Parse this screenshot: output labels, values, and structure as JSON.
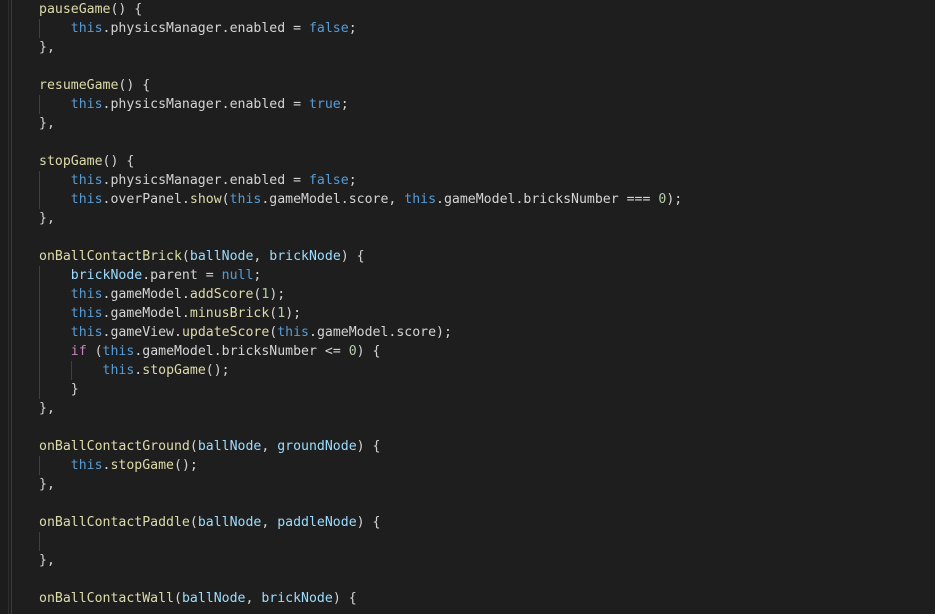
{
  "editor": {
    "language": "javascript",
    "theme_name": "dark-plus",
    "background_color": "#1e1e1e",
    "default_text_color": "#d4d4d4",
    "indent_guide_color": "#404040",
    "line_height_px": 19,
    "font_size_px": 13.2,
    "colors": {
      "function": "#dcdcaa",
      "this_keyword": "#569cd6",
      "parameter": "#9cdcfe",
      "control_keyword": "#c586c0",
      "constant": "#569cd6",
      "number": "#b5cea8",
      "plain": "#d4d4d4"
    },
    "lines": [
      {
        "n": 1,
        "indent": 0,
        "guides": [],
        "tokens": [
          {
            "t": "pauseGame",
            "c": "t-func"
          },
          {
            "t": "() {",
            "c": "t-punc"
          }
        ]
      },
      {
        "n": 2,
        "indent": 1,
        "guides": [
          0
        ],
        "tokens": [
          {
            "t": "    ",
            "c": "t-plain"
          },
          {
            "t": "this",
            "c": "t-this"
          },
          {
            "t": ".physicsManager.enabled ",
            "c": "t-plain"
          },
          {
            "t": "= ",
            "c": "t-op"
          },
          {
            "t": "false",
            "c": "t-const"
          },
          {
            "t": ";",
            "c": "t-punc"
          }
        ]
      },
      {
        "n": 3,
        "indent": 0,
        "guides": [],
        "tokens": [
          {
            "t": "},",
            "c": "t-punc"
          }
        ]
      },
      {
        "n": 4,
        "indent": 0,
        "guides": [],
        "tokens": []
      },
      {
        "n": 5,
        "indent": 0,
        "guides": [],
        "tokens": [
          {
            "t": "resumeGame",
            "c": "t-func"
          },
          {
            "t": "() {",
            "c": "t-punc"
          }
        ]
      },
      {
        "n": 6,
        "indent": 1,
        "guides": [
          0
        ],
        "tokens": [
          {
            "t": "    ",
            "c": "t-plain"
          },
          {
            "t": "this",
            "c": "t-this"
          },
          {
            "t": ".physicsManager.enabled ",
            "c": "t-plain"
          },
          {
            "t": "= ",
            "c": "t-op"
          },
          {
            "t": "true",
            "c": "t-const"
          },
          {
            "t": ";",
            "c": "t-punc"
          }
        ]
      },
      {
        "n": 7,
        "indent": 0,
        "guides": [],
        "tokens": [
          {
            "t": "},",
            "c": "t-punc"
          }
        ]
      },
      {
        "n": 8,
        "indent": 0,
        "guides": [],
        "tokens": []
      },
      {
        "n": 9,
        "indent": 0,
        "guides": [],
        "tokens": [
          {
            "t": "stopGame",
            "c": "t-func"
          },
          {
            "t": "() {",
            "c": "t-punc"
          }
        ]
      },
      {
        "n": 10,
        "indent": 1,
        "guides": [
          0
        ],
        "tokens": [
          {
            "t": "    ",
            "c": "t-plain"
          },
          {
            "t": "this",
            "c": "t-this"
          },
          {
            "t": ".physicsManager.enabled ",
            "c": "t-plain"
          },
          {
            "t": "= ",
            "c": "t-op"
          },
          {
            "t": "false",
            "c": "t-const"
          },
          {
            "t": ";",
            "c": "t-punc"
          }
        ]
      },
      {
        "n": 11,
        "indent": 1,
        "guides": [
          0
        ],
        "tokens": [
          {
            "t": "    ",
            "c": "t-plain"
          },
          {
            "t": "this",
            "c": "t-this"
          },
          {
            "t": ".overPanel.",
            "c": "t-plain"
          },
          {
            "t": "show",
            "c": "t-func"
          },
          {
            "t": "(",
            "c": "t-punc"
          },
          {
            "t": "this",
            "c": "t-this"
          },
          {
            "t": ".gameModel.score, ",
            "c": "t-plain"
          },
          {
            "t": "this",
            "c": "t-this"
          },
          {
            "t": ".gameModel.bricksNumber ",
            "c": "t-plain"
          },
          {
            "t": "=== ",
            "c": "t-op"
          },
          {
            "t": "0",
            "c": "t-num"
          },
          {
            "t": ");",
            "c": "t-punc"
          }
        ]
      },
      {
        "n": 12,
        "indent": 0,
        "guides": [],
        "tokens": [
          {
            "t": "},",
            "c": "t-punc"
          }
        ]
      },
      {
        "n": 13,
        "indent": 0,
        "guides": [],
        "tokens": []
      },
      {
        "n": 14,
        "indent": 0,
        "guides": [],
        "tokens": [
          {
            "t": "onBallContactBrick",
            "c": "t-func"
          },
          {
            "t": "(",
            "c": "t-punc"
          },
          {
            "t": "ballNode",
            "c": "t-param"
          },
          {
            "t": ", ",
            "c": "t-punc"
          },
          {
            "t": "brickNode",
            "c": "t-param"
          },
          {
            "t": ") {",
            "c": "t-punc"
          }
        ]
      },
      {
        "n": 15,
        "indent": 1,
        "guides": [
          0
        ],
        "tokens": [
          {
            "t": "    ",
            "c": "t-plain"
          },
          {
            "t": "brickNode",
            "c": "t-param"
          },
          {
            "t": ".parent ",
            "c": "t-plain"
          },
          {
            "t": "= ",
            "c": "t-op"
          },
          {
            "t": "null",
            "c": "t-const"
          },
          {
            "t": ";",
            "c": "t-punc"
          }
        ]
      },
      {
        "n": 16,
        "indent": 1,
        "guides": [
          0
        ],
        "tokens": [
          {
            "t": "    ",
            "c": "t-plain"
          },
          {
            "t": "this",
            "c": "t-this"
          },
          {
            "t": ".gameModel.",
            "c": "t-plain"
          },
          {
            "t": "addScore",
            "c": "t-func"
          },
          {
            "t": "(",
            "c": "t-punc"
          },
          {
            "t": "1",
            "c": "t-num"
          },
          {
            "t": ");",
            "c": "t-punc"
          }
        ]
      },
      {
        "n": 17,
        "indent": 1,
        "guides": [
          0
        ],
        "tokens": [
          {
            "t": "    ",
            "c": "t-plain"
          },
          {
            "t": "this",
            "c": "t-this"
          },
          {
            "t": ".gameModel.",
            "c": "t-plain"
          },
          {
            "t": "minusBrick",
            "c": "t-func"
          },
          {
            "t": "(",
            "c": "t-punc"
          },
          {
            "t": "1",
            "c": "t-num"
          },
          {
            "t": ");",
            "c": "t-punc"
          }
        ]
      },
      {
        "n": 18,
        "indent": 1,
        "guides": [
          0
        ],
        "tokens": [
          {
            "t": "    ",
            "c": "t-plain"
          },
          {
            "t": "this",
            "c": "t-this"
          },
          {
            "t": ".gameView.",
            "c": "t-plain"
          },
          {
            "t": "updateScore",
            "c": "t-func"
          },
          {
            "t": "(",
            "c": "t-punc"
          },
          {
            "t": "this",
            "c": "t-this"
          },
          {
            "t": ".gameModel.score",
            "c": "t-plain"
          },
          {
            "t": ");",
            "c": "t-punc"
          }
        ]
      },
      {
        "n": 19,
        "indent": 1,
        "guides": [
          0
        ],
        "tokens": [
          {
            "t": "    ",
            "c": "t-plain"
          },
          {
            "t": "if",
            "c": "t-kw"
          },
          {
            "t": " (",
            "c": "t-punc"
          },
          {
            "t": "this",
            "c": "t-this"
          },
          {
            "t": ".gameModel.bricksNumber ",
            "c": "t-plain"
          },
          {
            "t": "<= ",
            "c": "t-op"
          },
          {
            "t": "0",
            "c": "t-num"
          },
          {
            "t": ") {",
            "c": "t-punc"
          }
        ]
      },
      {
        "n": 20,
        "indent": 2,
        "guides": [
          0,
          1
        ],
        "tokens": [
          {
            "t": "        ",
            "c": "t-plain"
          },
          {
            "t": "this",
            "c": "t-this"
          },
          {
            "t": ".",
            "c": "t-plain"
          },
          {
            "t": "stopGame",
            "c": "t-func"
          },
          {
            "t": "();",
            "c": "t-punc"
          }
        ]
      },
      {
        "n": 21,
        "indent": 1,
        "guides": [
          0
        ],
        "tokens": [
          {
            "t": "    }",
            "c": "t-punc"
          }
        ]
      },
      {
        "n": 22,
        "indent": 0,
        "guides": [],
        "tokens": [
          {
            "t": "},",
            "c": "t-punc"
          }
        ]
      },
      {
        "n": 23,
        "indent": 0,
        "guides": [],
        "tokens": []
      },
      {
        "n": 24,
        "indent": 0,
        "guides": [],
        "tokens": [
          {
            "t": "onBallContactGround",
            "c": "t-func"
          },
          {
            "t": "(",
            "c": "t-punc"
          },
          {
            "t": "ballNode",
            "c": "t-param"
          },
          {
            "t": ", ",
            "c": "t-punc"
          },
          {
            "t": "groundNode",
            "c": "t-param"
          },
          {
            "t": ") {",
            "c": "t-punc"
          }
        ]
      },
      {
        "n": 25,
        "indent": 1,
        "guides": [
          0
        ],
        "tokens": [
          {
            "t": "    ",
            "c": "t-plain"
          },
          {
            "t": "this",
            "c": "t-this"
          },
          {
            "t": ".",
            "c": "t-plain"
          },
          {
            "t": "stopGame",
            "c": "t-func"
          },
          {
            "t": "();",
            "c": "t-punc"
          }
        ]
      },
      {
        "n": 26,
        "indent": 0,
        "guides": [],
        "tokens": [
          {
            "t": "},",
            "c": "t-punc"
          }
        ]
      },
      {
        "n": 27,
        "indent": 0,
        "guides": [],
        "tokens": []
      },
      {
        "n": 28,
        "indent": 0,
        "guides": [],
        "tokens": [
          {
            "t": "onBallContactPaddle",
            "c": "t-func"
          },
          {
            "t": "(",
            "c": "t-punc"
          },
          {
            "t": "ballNode",
            "c": "t-param"
          },
          {
            "t": ", ",
            "c": "t-punc"
          },
          {
            "t": "paddleNode",
            "c": "t-param"
          },
          {
            "t": ") {",
            "c": "t-punc"
          }
        ]
      },
      {
        "n": 29,
        "indent": 1,
        "guides": [
          0
        ],
        "tokens": []
      },
      {
        "n": 30,
        "indent": 0,
        "guides": [],
        "tokens": [
          {
            "t": "},",
            "c": "t-punc"
          }
        ]
      },
      {
        "n": 31,
        "indent": 0,
        "guides": [],
        "tokens": []
      },
      {
        "n": 32,
        "indent": 0,
        "guides": [],
        "tokens": [
          {
            "t": "onBallContactWall",
            "c": "t-func"
          },
          {
            "t": "(",
            "c": "t-punc"
          },
          {
            "t": "ballNode",
            "c": "t-param"
          },
          {
            "t": ", ",
            "c": "t-punc"
          },
          {
            "t": "brickNode",
            "c": "t-param"
          },
          {
            "t": ") {",
            "c": "t-punc"
          }
        ]
      }
    ]
  }
}
